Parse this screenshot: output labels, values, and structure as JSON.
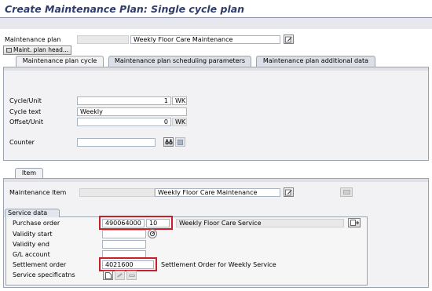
{
  "title": "Create Maintenance Plan: Single cycle plan",
  "header": {
    "plan_label": "Maintenance plan",
    "plan_number": "",
    "plan_text": "Weekly Floor Care Maintenance",
    "maint_head_button": "Maint. plan head..."
  },
  "tabs": [
    {
      "label": "Maintenance plan cycle"
    },
    {
      "label": "Maintenance plan scheduling parameters"
    },
    {
      "label": "Maintenance plan additional data"
    }
  ],
  "cycle": {
    "cycle_unit_label": "Cycle/Unit",
    "cycle_value": "1",
    "cycle_unit": "WK",
    "cycle_text_label": "Cycle text",
    "cycle_text": "Weekly",
    "offset_label": "Offset/Unit",
    "offset_value": "0",
    "offset_unit": "WK",
    "counter_label": "Counter",
    "counter_value": ""
  },
  "item_tab": {
    "label": "Item"
  },
  "item": {
    "maint_item_label": "Maintenance Item",
    "maint_item_number": "",
    "maint_item_text": "Weekly Floor Care Maintenance"
  },
  "service_data": {
    "section_title": "Service data",
    "po_label": "Purchase order",
    "po_number": "490064000",
    "po_item": "10",
    "po_text": "Weekly Floor Care Service",
    "validity_start_label": "Validity start",
    "validity_start": "",
    "validity_end_label": "Validity end",
    "validity_end": "",
    "gl_account_label": "G/L account",
    "gl_account": "",
    "settlement_order_label": "Settlement order",
    "settlement_order": "4021600",
    "settlement_text": "Settlement Order for Weekly Service",
    "service_spec_label": "Service specificatns"
  },
  "colors": {
    "title": "#2f3c6c",
    "highlight_box": "#c8202a",
    "panel_bg": "#f2f2f4"
  },
  "icons": [
    "edit-icon",
    "binoculars-icon",
    "document-icon",
    "search-help-icon"
  ]
}
